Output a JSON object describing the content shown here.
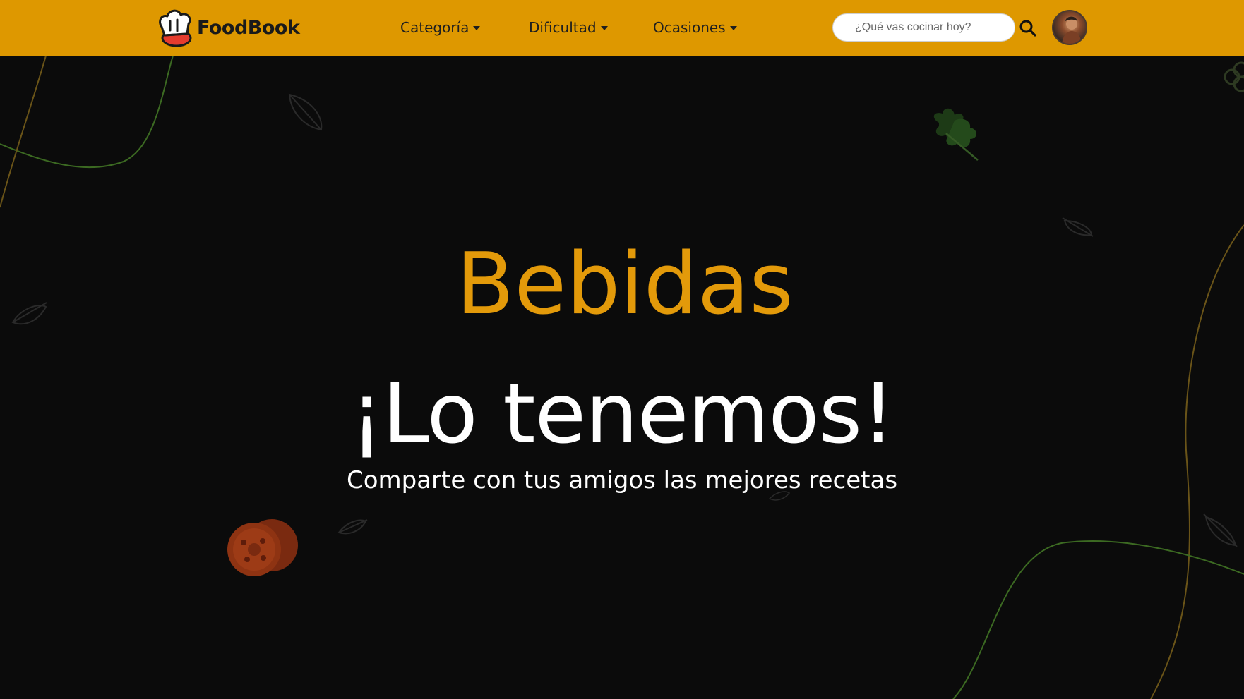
{
  "brand": {
    "name": "FoodBook",
    "logo_icon": "chef-hat-logo-icon"
  },
  "nav": {
    "items": [
      {
        "label": "Categoría"
      },
      {
        "label": "Dificultad"
      },
      {
        "label": "Ocasiones"
      }
    ]
  },
  "search": {
    "placeholder": "¿Qué vas cocinar hoy?",
    "value": "",
    "icon": "search-icon"
  },
  "user": {
    "avatar_icon": "user-avatar"
  },
  "hero": {
    "title": "Bebidas",
    "headline": "¡Lo tenemos!",
    "subtitle": "Comparte con tus amigos las mejores recetas"
  },
  "colors": {
    "navbar_bg": "#de9800",
    "accent": "#e39a0a",
    "hero_bg": "#0b0b0b",
    "text_light": "#ffffff",
    "text_dark": "#1f1f1f"
  }
}
